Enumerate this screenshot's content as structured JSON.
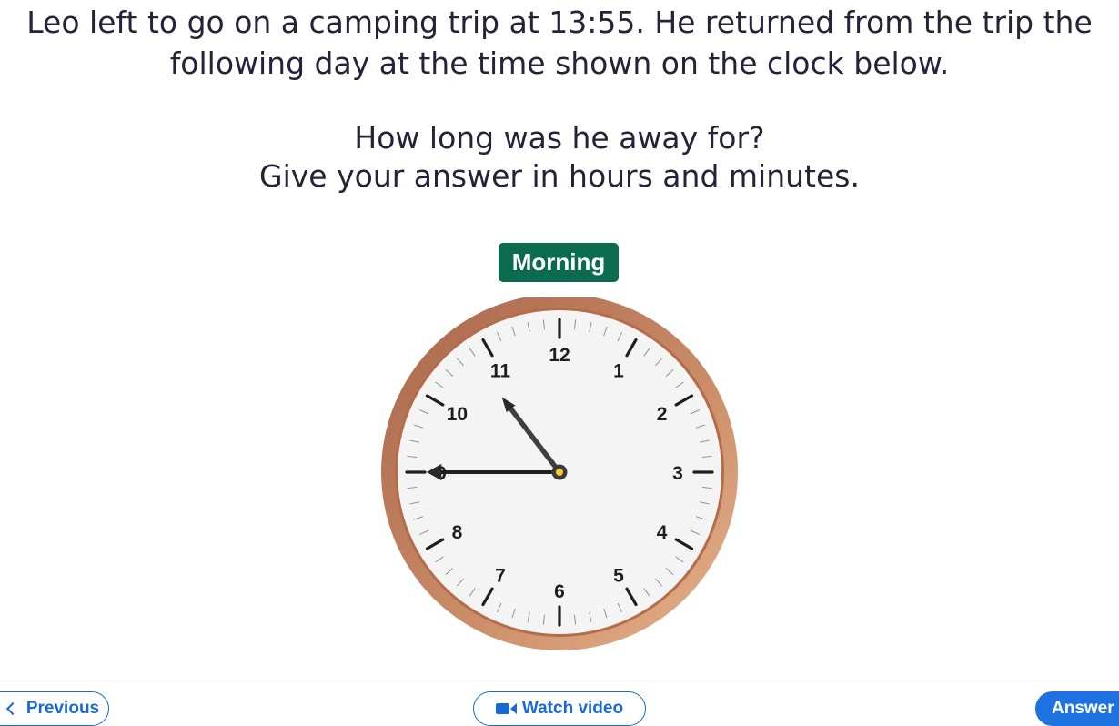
{
  "question": {
    "line1": "Leo left to go on a camping trip at 13:55. He returned from the trip the",
    "line2": "following day at the time shown on the clock below.",
    "line3": "How long was he away for?",
    "line4": "Give your answer in hours and minutes."
  },
  "clock": {
    "period_label": "Morning",
    "numbers": [
      "12",
      "1",
      "2",
      "3",
      "4",
      "5",
      "6",
      "7",
      "8",
      "9",
      "10",
      "11"
    ],
    "hour": 10,
    "minute": 45,
    "colors": {
      "rim_outer": "#c98a66",
      "rim_inner": "#b36f4d",
      "face": "#f4f4f4",
      "hand": "#3a3a3a",
      "center": "#f6c52a",
      "label_bg": "#0b6b4f"
    }
  },
  "nav": {
    "previous_label": "Previous",
    "video_label": "Watch video",
    "answer_label": "Answer",
    "icons": {
      "previous": "chevron-left-icon",
      "video": "video-camera-icon"
    },
    "accent_color": "#1769d6"
  }
}
